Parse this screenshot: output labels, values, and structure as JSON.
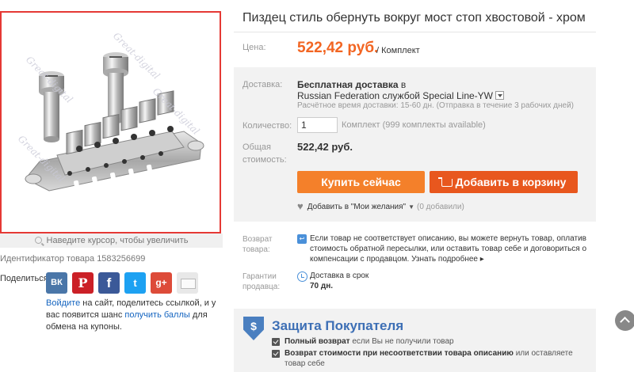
{
  "product": {
    "title": "Пиздец стиль обернуть вокруг мост стоп хвостовой - хром",
    "image_hint": "Наведите курсор, чтобы увеличить",
    "id_label": "Идентификатор товара 1583256699",
    "watermark": "Great-digital"
  },
  "price": {
    "label": "Цена:",
    "value": "522,42 руб.",
    "unit": "/ Комплект"
  },
  "shipping": {
    "label": "Доставка:",
    "free": "Бесплатная доставка",
    "in": "в",
    "destination": "Russian Federation",
    "service": "службой Special Line-YW",
    "estimate": "Расчётное время доставки: 15-60 дн. (Отправка в течение 3 рабочих дней)"
  },
  "quantity": {
    "label": "Количество:",
    "value": "1",
    "note": "Комплект (999 комплекты available)"
  },
  "total": {
    "label_line1": "Общая",
    "label_line2": "стоимость:",
    "value": "522,42 руб."
  },
  "buttons": {
    "buy": "Купить сейчас",
    "cart": "Добавить в корзину"
  },
  "wishlist": {
    "label": "Добавить в \"Мои желания\"",
    "count": "(0 добавили)"
  },
  "returns": {
    "label_line1": "Возврат",
    "label_line2": "товара:",
    "text": "Если товар не соответствует описанию, вы можете вернуть товар, оплатив стоимость обратной пересылки, или оставить товар себе и договориться о компенсации с продавцом.",
    "more": "Узнать подробнее ▸"
  },
  "guarantee": {
    "label_line1": "Гарантии",
    "label_line2": "продавца:",
    "line1": "Доставка в срок",
    "line2": "70 дн."
  },
  "protection": {
    "title": "Защита Покупателя",
    "item1_bold": "Полный возврат",
    "item1_rest": "если Вы не получили товар",
    "item2_bold": "Возврат стоимости при несоответствии товара описанию",
    "item2_rest": "или оставляете товар себе"
  },
  "share": {
    "label": "Поделиться:",
    "icons": [
      "vk-icon",
      "pinterest-icon",
      "facebook-icon",
      "twitter-icon",
      "google-plus-icon",
      "mail-icon"
    ],
    "vk": "ВК",
    "pin": "P",
    "fb": "f",
    "tw": "t",
    "gp": "g+",
    "text_link1": "Войдите",
    "text_part1": "на сайт, поделитесь ссылкой, и у вас появится шанс",
    "text_link2": "получить баллы",
    "text_part2": "для обмена на купоны."
  },
  "colors": {
    "accent_orange": "#f26522",
    "buy_button": "#f4802a",
    "cart_button": "#e8571e",
    "image_border": "#e53935",
    "link_blue": "#1565c0",
    "protection_blue": "#3d6fb5"
  }
}
